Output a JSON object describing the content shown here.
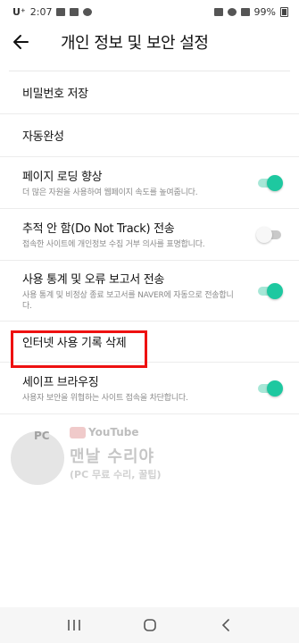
{
  "status_bar": {
    "carrier": "U⁺",
    "time": "2:07",
    "battery": "99%"
  },
  "header": {
    "title": "개인 정보 및 보안 설정"
  },
  "settings": [
    {
      "title": "비밀번호 저장"
    },
    {
      "title": "자동완성"
    },
    {
      "title": "페이지 로딩 향상",
      "desc": "더 많은 자원을 사용하여 웹페이지 속도를 높여줍니다.",
      "toggle": "on"
    },
    {
      "title": "추적 안 함(Do Not Track) 전송",
      "desc": "접속한 사이트에 개인정보 수집 거부 의사를 표명합니다.",
      "toggle": "off"
    },
    {
      "title": "사용 통계 및 오류 보고서 전송",
      "desc": "사용 통계 및 비정상 종료 보고서를 NAVER에 자동으로 전송합니다.",
      "toggle": "on"
    },
    {
      "title": "인터넷 사용 기록 삭제"
    },
    {
      "title": "세이프 브라우징",
      "desc": "사용자 보안을 위협하는 사이트 접속을 차단합니다.",
      "toggle": "on"
    }
  ],
  "watermark": {
    "badge": "PC",
    "youtube": "YouTube",
    "channel": "맨날 수리야",
    "subtitle": "(PC 무료 수리, 꿀팁)"
  },
  "colors": {
    "toggle_on": "#1ec8a0",
    "highlight": "#ee1111"
  },
  "icons": {
    "back": "arrow-left-icon",
    "nav_recent": "recent-apps-icon",
    "nav_home": "home-icon",
    "nav_back": "chevron-left-icon"
  }
}
